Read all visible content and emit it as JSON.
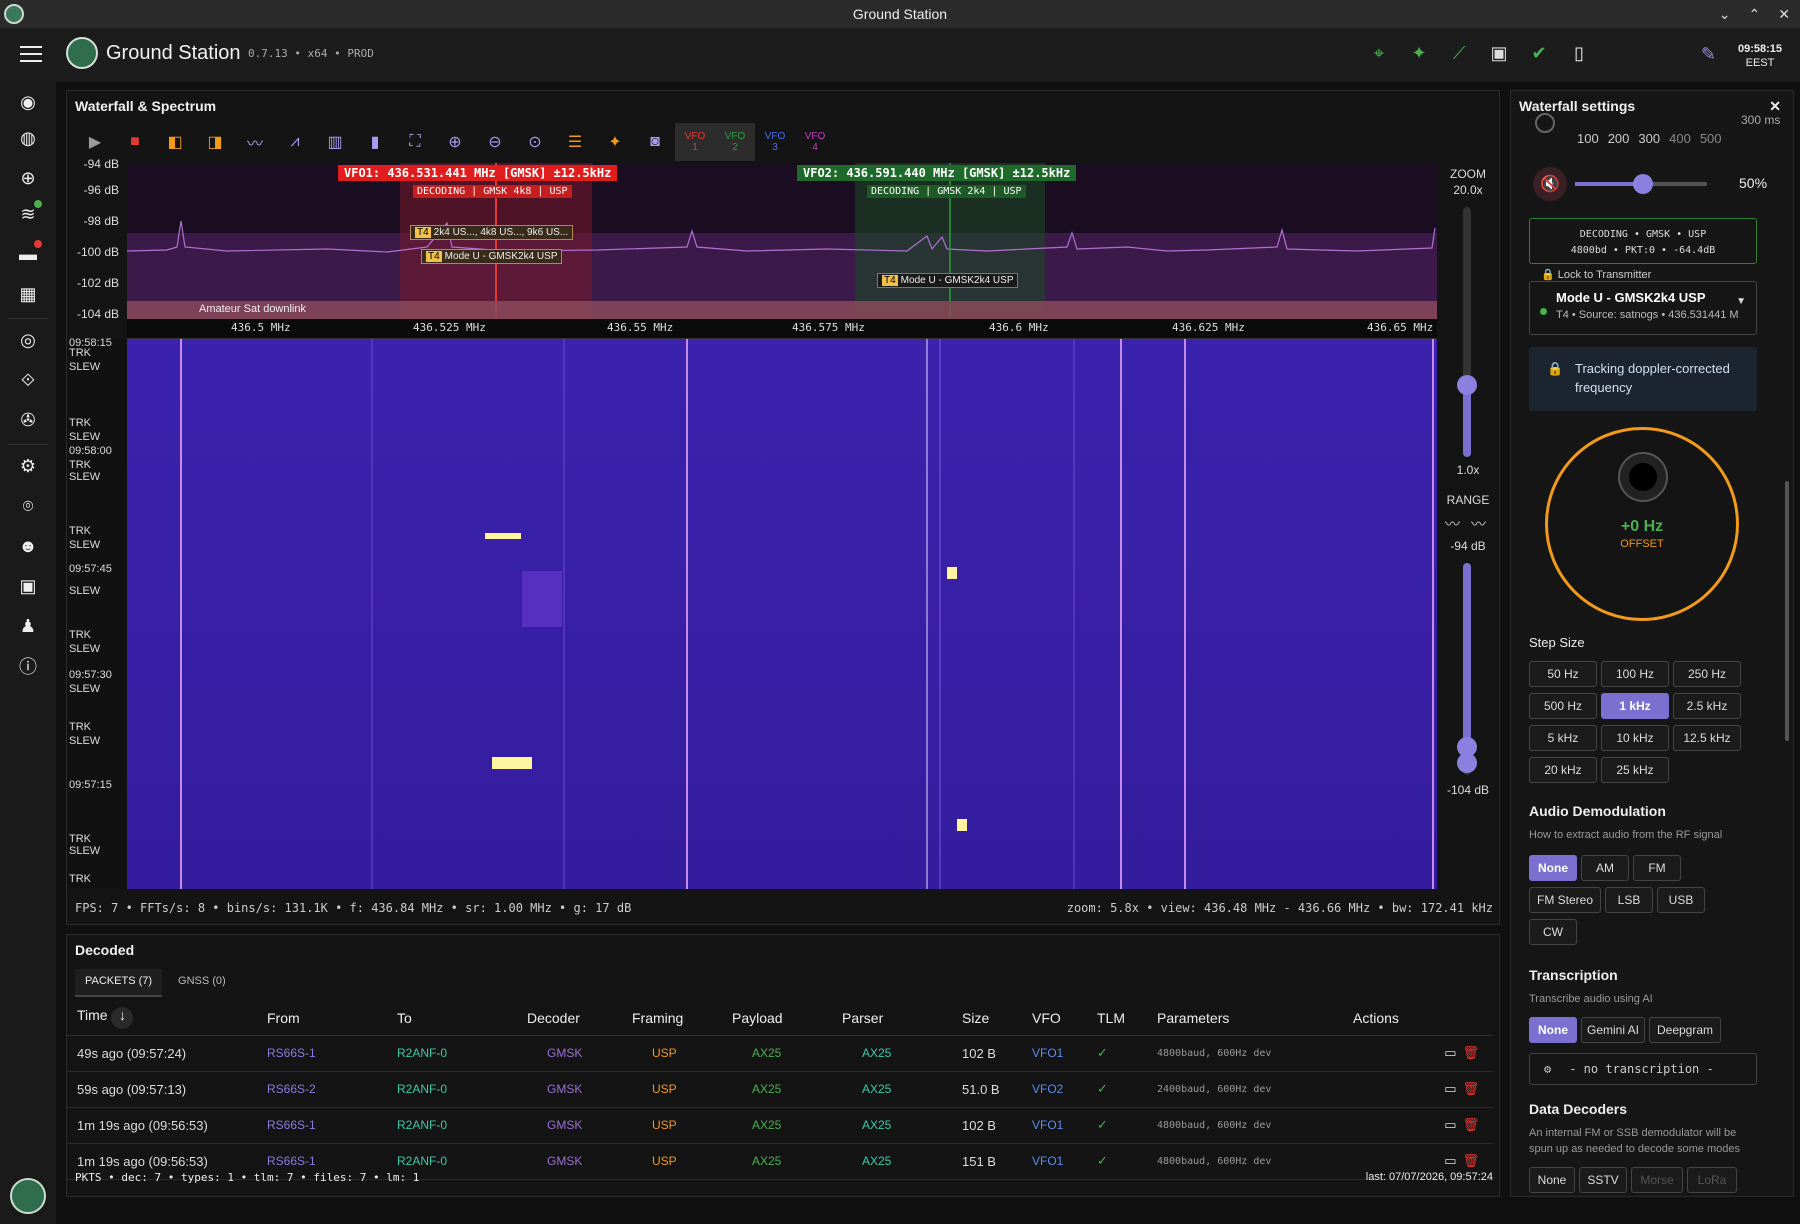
{
  "window": {
    "title": "Ground Station"
  },
  "app": {
    "name": "Ground Station",
    "version": "0.7.13 • x64 • PROD",
    "time": "09:58:15",
    "timezone": "EEST"
  },
  "waterfall": {
    "title": "Waterfall & Spectrum",
    "vfos": [
      "VFO\n1",
      "VFO\n2",
      "VFO\n3",
      "VFO\n4"
    ],
    "vfo_labels": {
      "vfo1": "VFO1: 436.531.441 MHz [GMSK] ±12.5kHz",
      "vfo2": "VFO2: 436.591.440 MHz [GMSK] ±12.5kHz",
      "dec1": "DECODING | GMSK 4k8 | USP",
      "dec2": "DECODING | GMSK 2k4 | USP",
      "tx1a": "2k4 US..., 4k8 US..., 9k6 US...",
      "tx1b": "Mode U - GMSK2k4 USP",
      "tx2": "Mode U - GMSK2k4 USP",
      "t4": "T4",
      "band": "Amateur Sat downlink"
    },
    "db_labels": [
      "-94 dB",
      "-96 dB",
      "-98 dB",
      "-100 dB",
      "-102 dB",
      "-104 dB"
    ],
    "freq_labels": [
      "436.5 MHz",
      "436.525 MHz",
      "436.55 MHz",
      "436.575 MHz",
      "436.6 MHz",
      "436.625 MHz",
      "436.65 MHz"
    ],
    "time_labels": [
      "09:58:15",
      "09:58:00",
      "09:57:45",
      "09:57:30",
      "09:57:15"
    ],
    "trk": "TRK",
    "slew": "SLEW",
    "zoom": {
      "label": "ZOOM",
      "max": "20.0x",
      "min": "1.0x"
    },
    "range": {
      "label": "RANGE",
      "top": "-94 dB",
      "bottom": "-104 dB"
    },
    "status_left": "FPS:    7 • FFTs/s:    8 • bins/s: 131.1K • f: 436.84 MHz • sr: 1.00 MHz • g: 17 dB",
    "status_right": "zoom: 5.8x • view: 436.48 MHz - 436.66 MHz • bw: 172.41 kHz"
  },
  "decoded": {
    "title": "Decoded",
    "tabs": [
      "PACKETS (7)",
      "GNSS (0)"
    ],
    "columns": [
      "Time",
      "From",
      "To",
      "Decoder",
      "Framing",
      "Payload",
      "Parser",
      "Size",
      "VFO",
      "TLM",
      "Parameters",
      "Actions"
    ],
    "rows": [
      {
        "time": "49s ago (09:57:24)",
        "from": "RS66S-1",
        "to": "R2ANF-0",
        "decoder": "GMSK",
        "framing": "USP",
        "payload": "AX25",
        "parser": "AX25",
        "size": "102 B",
        "vfo": "VFO1",
        "tlm": "✓",
        "params": "4800baud, 600Hz dev"
      },
      {
        "time": "59s ago (09:57:13)",
        "from": "RS66S-2",
        "to": "R2ANF-0",
        "decoder": "GMSK",
        "framing": "USP",
        "payload": "AX25",
        "parser": "AX25",
        "size": "51.0 B",
        "vfo": "VFO2",
        "tlm": "✓",
        "params": "2400baud, 600Hz dev"
      },
      {
        "time": "1m 19s ago (09:56:53)",
        "from": "RS66S-1",
        "to": "R2ANF-0",
        "decoder": "GMSK",
        "framing": "USP",
        "payload": "AX25",
        "parser": "AX25",
        "size": "102 B",
        "vfo": "VFO1",
        "tlm": "✓",
        "params": "4800baud, 600Hz dev"
      },
      {
        "time": "1m 19s ago (09:56:53)",
        "from": "RS66S-1",
        "to": "R2ANF-0",
        "decoder": "GMSK",
        "framing": "USP",
        "payload": "AX25",
        "parser": "AX25",
        "size": "151 B",
        "vfo": "VFO1",
        "tlm": "✓",
        "params": "4800baud, 600Hz dev"
      }
    ],
    "footer_left": "PKTS • dec: 7 • types: 1 • tlm: 7 • files: 7 • lm: 1",
    "footer_right": "last: 07/07/2026, 09:57:24"
  },
  "settings": {
    "title": "Waterfall settings",
    "top_partial": "300 ms",
    "rates": [
      "100",
      "200",
      "300",
      "400",
      "500"
    ],
    "volume": "50%",
    "volume_level": 0.5,
    "decode_line1": "DECODING • GMSK • USP",
    "decode_line2": "4800bd • PKT:0 • -64.4dB",
    "lock_label": "Lock to Transmitter",
    "tx_name": "Mode U - GMSK2k4 USP",
    "tx_sub": "T4 • Source: satnogs • 436.531441 M",
    "tracking": "Tracking doppler-corrected frequency",
    "offset_value": "+0 Hz",
    "offset_label": "OFFSET",
    "step_title": "Step Size",
    "steps": [
      "50 Hz",
      "100 Hz",
      "250 Hz",
      "500 Hz",
      "1 kHz",
      "2.5 kHz",
      "5 kHz",
      "10 kHz",
      "12.5 kHz",
      "20 kHz",
      "25 kHz"
    ],
    "step_selected": "1 kHz",
    "demod_title": "Audio Demodulation",
    "demod_sub": "How to extract audio from the RF signal",
    "demods": [
      "None",
      "AM",
      "FM",
      "FM Stereo",
      "LSB",
      "USB",
      "CW"
    ],
    "trans_title": "Transcription",
    "trans_sub": "Transcribe audio using AI",
    "trans_opts": [
      "None",
      "Gemini AI",
      "Deepgram"
    ],
    "trans_value": "- no transcription -",
    "dd_title": "Data Decoders",
    "dd_sub": "An internal FM or SSB demodulator will be spun up as needed to decode some modes",
    "dd_opts": [
      "None",
      "SSTV",
      "Morse",
      "LoRa"
    ]
  },
  "colors": {
    "accent": "#7b6fd0",
    "vfo1": "#e53935",
    "vfo2": "#2e7d32",
    "waterfall": "#3a20a8",
    "offset_ring": "#f29a1a",
    "green": "#4caf50"
  }
}
